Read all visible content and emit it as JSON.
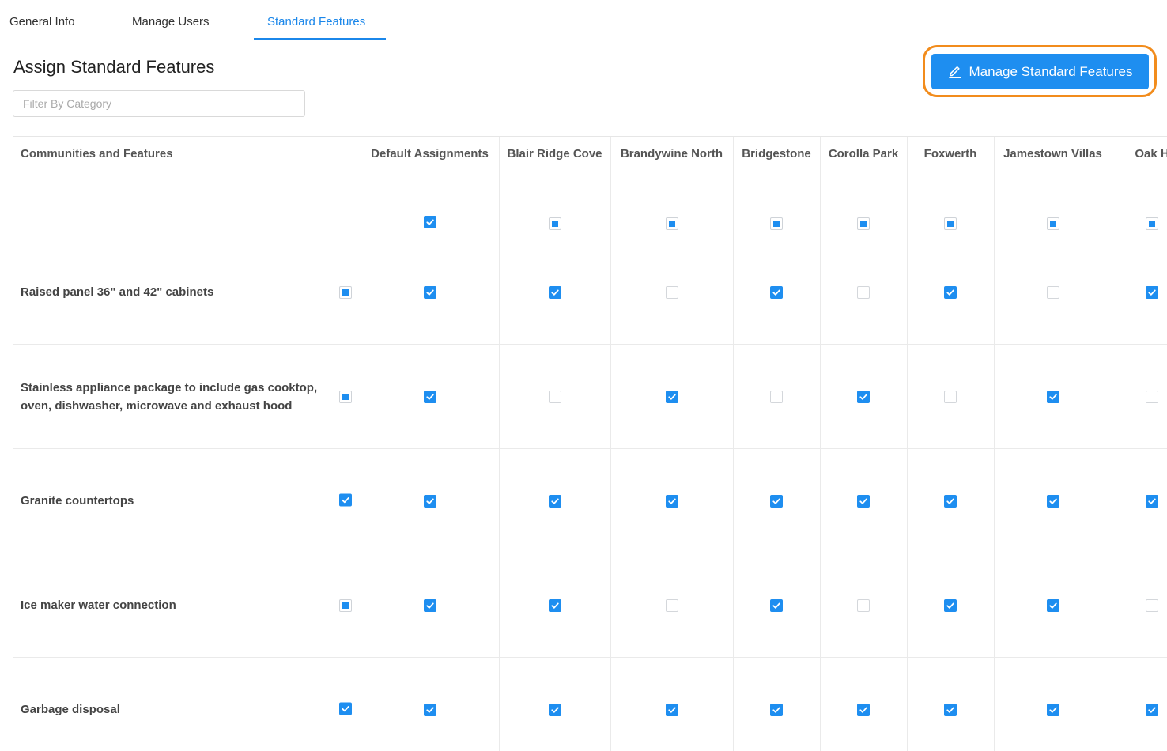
{
  "tabs": [
    {
      "label": "General Info",
      "active": false
    },
    {
      "label": "Manage Users",
      "active": false
    },
    {
      "label": "Standard Features",
      "active": true
    }
  ],
  "page": {
    "title": "Assign Standard Features",
    "filter_placeholder": "Filter By Category",
    "manage_button_label": "Manage Standard Features",
    "manage_button_icon": "edit-pencil-icon"
  },
  "colors": {
    "accent": "#1e8ef0",
    "highlight": "#f28c1c"
  },
  "table": {
    "first_column_header": "Communities and Features",
    "columns": [
      {
        "label": "Default Assignments",
        "state": "checked"
      },
      {
        "label": "Blair Ridge Cove",
        "state": "partial"
      },
      {
        "label": "Brandywine North",
        "state": "partial"
      },
      {
        "label": "Bridgestone",
        "state": "partial"
      },
      {
        "label": "Corolla Park",
        "state": "partial"
      },
      {
        "label": "Foxwerth",
        "state": "partial"
      },
      {
        "label": "Jamestown Villas",
        "state": "partial"
      },
      {
        "label": "Oak H",
        "state": "partial"
      }
    ],
    "rows": [
      {
        "label": "Raised panel 36\" and 42\" cabinets",
        "state": "partial",
        "cells": [
          "checked",
          "checked",
          "unchecked",
          "checked",
          "unchecked",
          "checked",
          "unchecked",
          "checked"
        ]
      },
      {
        "label": "Stainless appliance package to include gas cooktop, oven, dishwasher, microwave and exhaust hood",
        "state": "partial",
        "cells": [
          "checked",
          "unchecked",
          "checked",
          "unchecked",
          "checked",
          "unchecked",
          "checked",
          "unchecked"
        ]
      },
      {
        "label": "Granite countertops",
        "state": "checked",
        "cells": [
          "checked",
          "checked",
          "checked",
          "checked",
          "checked",
          "checked",
          "checked",
          "checked"
        ]
      },
      {
        "label": "Ice maker water connection",
        "state": "partial",
        "cells": [
          "checked",
          "checked",
          "unchecked",
          "checked",
          "unchecked",
          "checked",
          "checked",
          "unchecked"
        ]
      },
      {
        "label": "Garbage disposal",
        "state": "checked",
        "cells": [
          "checked",
          "checked",
          "checked",
          "checked",
          "checked",
          "checked",
          "checked",
          "checked"
        ]
      }
    ]
  }
}
